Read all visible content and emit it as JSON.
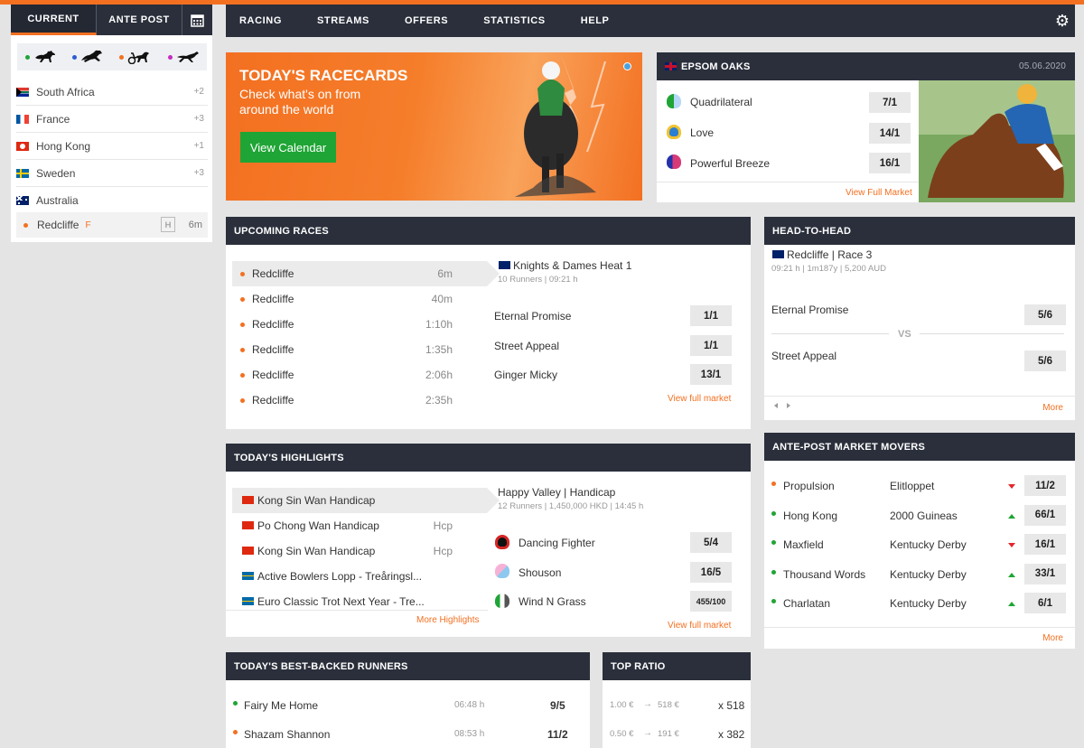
{
  "sidebar": {
    "tabs": [
      {
        "label": "CURRENT"
      },
      {
        "label": "ANTE POST"
      }
    ],
    "sports": [
      {
        "color": "#1fa535"
      },
      {
        "color": "#2d5bd7"
      },
      {
        "color": "#f37021"
      },
      {
        "color": "#c72bc1"
      }
    ],
    "countries": [
      {
        "name": "South Africa",
        "count": "+2"
      },
      {
        "name": "France",
        "count": "+3"
      },
      {
        "name": "Hong Kong",
        "count": "+1"
      },
      {
        "name": "Sweden",
        "count": "+3"
      },
      {
        "name": "Australia",
        "count": ""
      }
    ],
    "selected_race": {
      "name": "Redcliffe",
      "tag": "F",
      "badge": "H",
      "time": "6m"
    }
  },
  "nav": {
    "items": [
      "RACING",
      "STREAMS",
      "OFFERS",
      "STATISTICS",
      "HELP"
    ]
  },
  "banner": {
    "title": "TODAY'S RACECARDS",
    "subtitle": "Check what's on from around the world",
    "button": "View Calendar"
  },
  "featured": {
    "title": "EPSOM OAKS",
    "date": "05.06.2020",
    "runners": [
      {
        "name": "Quadrilateral",
        "odds": "7/1"
      },
      {
        "name": "Love",
        "odds": "14/1"
      },
      {
        "name": "Powerful Breeze",
        "odds": "16/1"
      }
    ],
    "link": "View Full Market"
  },
  "upcoming": {
    "title": "UPCOMING RACES",
    "races": [
      {
        "name": "Redcliffe",
        "time": "6m"
      },
      {
        "name": "Redcliffe",
        "time": "40m"
      },
      {
        "name": "Redcliffe",
        "time": "1:10h"
      },
      {
        "name": "Redcliffe",
        "time": "1:35h"
      },
      {
        "name": "Redcliffe",
        "time": "2:06h"
      },
      {
        "name": "Redcliffe",
        "time": "2:35h"
      }
    ],
    "detail": {
      "race": "Knights & Dames Heat 1",
      "meta": "10 Runners | 09:21 h",
      "runners": [
        {
          "name": "Eternal Promise",
          "odds": "1/1"
        },
        {
          "name": "Street Appeal",
          "odds": "1/1"
        },
        {
          "name": "Ginger Micky",
          "odds": "13/1"
        }
      ],
      "link": "View full market"
    }
  },
  "h2h": {
    "title": "HEAD-TO-HEAD",
    "race": "Redcliffe | Race 3",
    "meta": "09:21 h | 1m187y | 5,200 AUD",
    "a": {
      "name": "Eternal Promise",
      "odds": "5/6"
    },
    "vs": "VS",
    "b": {
      "name": "Street Appeal",
      "odds": "5/6"
    },
    "more": "More"
  },
  "highlights": {
    "title": "TODAY'S HIGHLIGHTS",
    "races": [
      {
        "name": "Kong Sin Wan Handicap",
        "tag": ""
      },
      {
        "name": "Po Chong Wan Handicap",
        "tag": "Hcp"
      },
      {
        "name": "Kong Sin Wan Handicap",
        "tag": "Hcp"
      },
      {
        "name": "Active Bowlers Lopp - Treåringsl...",
        "tag": ""
      },
      {
        "name": "Euro Classic Trot Next Year - Tre...",
        "tag": ""
      }
    ],
    "more": "More Highlights",
    "detail": {
      "race": "Happy Valley | Handicap",
      "meta": "12 Runners | 1,450,000 HKD | 14:45 h",
      "runners": [
        {
          "name": "Dancing Fighter",
          "odds": "5/4"
        },
        {
          "name": "Shouson",
          "odds": "16/5"
        },
        {
          "name": "Wind N Grass",
          "odds": "455/100"
        }
      ],
      "link": "View full market"
    }
  },
  "movers": {
    "title": "ANTE-POST MARKET MOVERS",
    "rows": [
      {
        "name": "Propulsion",
        "race": "Elitloppet",
        "dir": "down",
        "odds": "11/2",
        "dot": "#f37021"
      },
      {
        "name": "Hong Kong",
        "race": "2000 Guineas",
        "dir": "up",
        "odds": "66/1",
        "dot": "#1fa535"
      },
      {
        "name": "Maxfield",
        "race": "Kentucky Derby",
        "dir": "down",
        "odds": "16/1",
        "dot": "#1fa535"
      },
      {
        "name": "Thousand Words",
        "race": "Kentucky Derby",
        "dir": "up",
        "odds": "33/1",
        "dot": "#1fa535"
      },
      {
        "name": "Charlatan",
        "race": "Kentucky Derby",
        "dir": "up",
        "odds": "6/1",
        "dot": "#1fa535"
      }
    ],
    "more": "More"
  },
  "best_backed": {
    "title": "TODAY'S BEST-BACKED RUNNERS",
    "rows": [
      {
        "name": "Fairy Me Home",
        "time": "06:48 h",
        "odds": "9/5",
        "dot": "#1fa535"
      },
      {
        "name": "Shazam Shannon",
        "time": "08:53 h",
        "odds": "11/2",
        "dot": "#f37021"
      }
    ]
  },
  "top_ratio": {
    "title": "TOP RATIO",
    "rows": [
      {
        "stake": "1.00 €",
        "arrow": "→",
        "ret": "518 €",
        "ratio": "x 518"
      },
      {
        "stake": "0.50 €",
        "arrow": "→",
        "ret": "191 €",
        "ratio": "x 382"
      }
    ]
  },
  "colors": {
    "accent": "#f37021",
    "header": "#2a2f3b",
    "green": "#1fa535"
  }
}
